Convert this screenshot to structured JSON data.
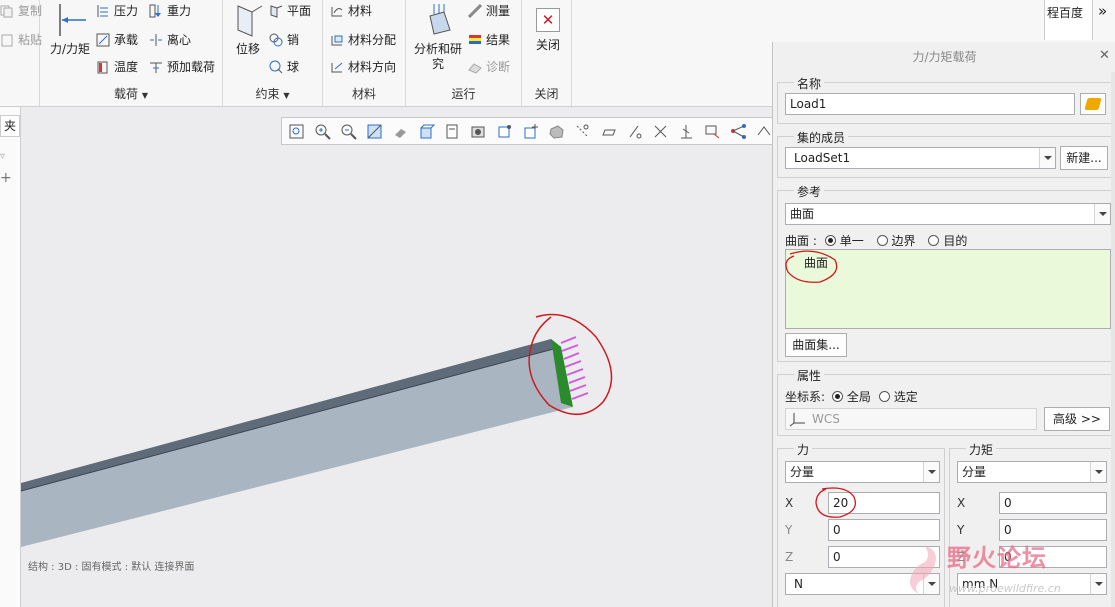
{
  "ribbon": {
    "clipboard": {
      "copy": "复制",
      "paste": "粘贴"
    },
    "loads": {
      "force_moment": "力/力矩",
      "pressure": "压力",
      "gravity": "重力",
      "bearing": "承载",
      "centrifugal": "离心",
      "temperature": "温度",
      "preload": "预加载荷",
      "group": "载荷"
    },
    "constraints": {
      "displacement": "位移",
      "plane": "平面",
      "pin": "销",
      "ball": "球",
      "group": "约束"
    },
    "materials": {
      "material": "材料",
      "assignment": "材料分配",
      "orientation": "材料方向",
      "group": "材料"
    },
    "run": {
      "analysis_line1": "分析和研",
      "analysis_line2": "究",
      "measure": "测量",
      "results": "结果",
      "diagnostics": "诊断",
      "group": "运行"
    },
    "close": {
      "label": "关闭",
      "group": "关闭"
    },
    "browser_tab": "程百度",
    "more": "»"
  },
  "left_strip": {
    "tab_text": "夹"
  },
  "canvas": {
    "status": "结构 : 3D : 固有模式 : 默认 连接界面"
  },
  "dialog": {
    "title": "力/力矩载荷",
    "name": {
      "label": "名称",
      "value": "Load1"
    },
    "set_members": {
      "label": "集的成员",
      "value": "LoadSet1",
      "new_button": "新建..."
    },
    "reference": {
      "label": "参考",
      "type": "曲面",
      "surface_label": "曲面 :",
      "options": [
        "单一",
        "边界",
        "目的"
      ],
      "selected_option": "单一",
      "list_items": [
        "曲面"
      ],
      "surface_set_button": "曲面集..."
    },
    "properties": {
      "label": "属性",
      "coord_label": "坐标系:",
      "coord_options": [
        "全局",
        "选定"
      ],
      "coord_selected": "全局",
      "coord_value": "WCS",
      "advanced_button": "高级 >>"
    },
    "force": {
      "label": "力",
      "mode": "分量",
      "x_label": "X",
      "x": "20",
      "y_label": "Y",
      "y": "0",
      "z_label": "Z",
      "z": "0",
      "unit": "N"
    },
    "moment": {
      "label": "力矩",
      "mode": "分量",
      "x_label": "X",
      "x": "0",
      "y_label": "Y",
      "y": "0",
      "z_label": "Z",
      "z": "0",
      "unit": "mm N"
    }
  },
  "watermark": {
    "text": "野火论坛",
    "url": "www.proewildfire.cn"
  },
  "colors": {
    "beam": "#a9b6c2",
    "load_arrows": "#d15ae0",
    "surface_highlight": "#2b8a2b",
    "list_bg": "#eaf9d9",
    "annotation": "#d0191e"
  }
}
